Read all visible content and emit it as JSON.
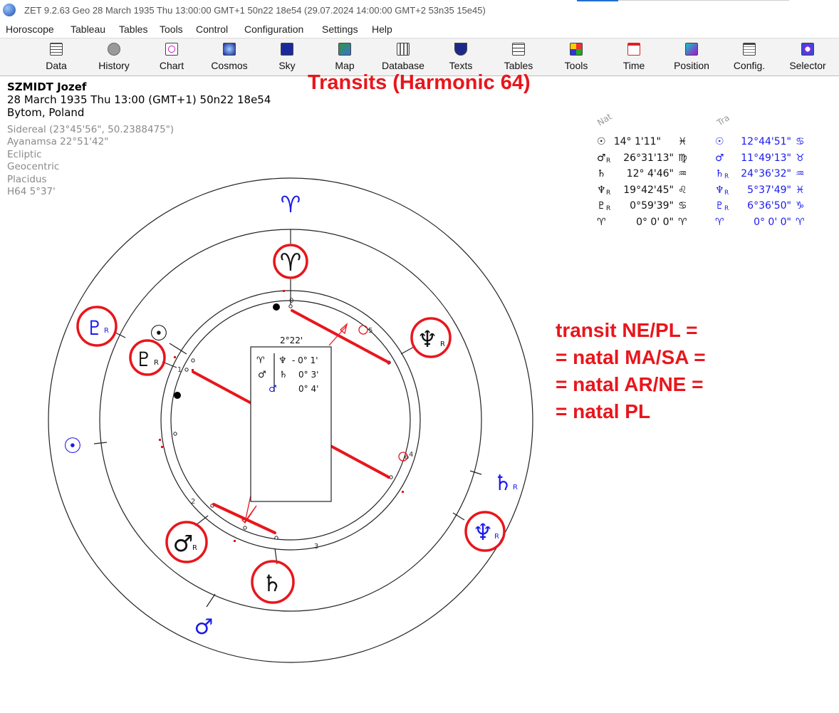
{
  "window": {
    "title": "ZET 9.2.63 Geo   28 March 1935  Thu  13:00:00 GMT+1 50n22  18e54  (29.07.2024  14:00:00 GMT+2 53n35 15e45)"
  },
  "menu": [
    "Horoscope",
    "Tableau",
    "Tables",
    "Tools",
    "Control",
    "Configuration",
    "Settings",
    "Help"
  ],
  "toolbar": [
    "Data",
    "History",
    "Chart",
    "Cosmos",
    "Sky",
    "Map",
    "Database",
    "Texts",
    "Tables",
    "Tools",
    "Time",
    "Position",
    "Config.",
    "Selector"
  ],
  "chart_title": "Transits (Harmonic 64)",
  "person": {
    "name": "SZMIDT Jozef",
    "datetime": "28 March 1935  Thu  13:00 (GMT+1) 50n22  18e54",
    "place": "Bytom, Poland",
    "settings": [
      "Sidereal (23°45'56\", 50.2388475\")",
      "Ayanamsa 22°51'42\"",
      "Ecliptic",
      "Geocentric",
      "Placidus",
      "H64   5°37'"
    ]
  },
  "table": {
    "nat_header": "Nat",
    "tra_header": "Tra",
    "nat_rows": [
      {
        "glyph": "☉",
        "retro": "",
        "pos": "14° 1'11\"",
        "sign": "♓"
      },
      {
        "glyph": "♂",
        "retro": "R",
        "pos": "26°31'13\"",
        "sign": "♍"
      },
      {
        "glyph": "♄",
        "retro": "",
        "pos": "12° 4'46\"",
        "sign": "♒"
      },
      {
        "glyph": "♆",
        "retro": "R",
        "pos": "19°42'45\"",
        "sign": "♌"
      },
      {
        "glyph": "♇",
        "retro": "R",
        "pos": "0°59'39\"",
        "sign": "♋"
      },
      {
        "glyph": "♈",
        "retro": "",
        "pos": "0° 0' 0\"",
        "sign": "♈"
      }
    ],
    "tra_rows": [
      {
        "glyph": "☉",
        "retro": "",
        "pos": "12°44'51\"",
        "sign": "♋"
      },
      {
        "glyph": "♂",
        "retro": "",
        "pos": "11°49'13\"",
        "sign": "♉"
      },
      {
        "glyph": "♄",
        "retro": "R",
        "pos": "24°36'32\"",
        "sign": "♒"
      },
      {
        "glyph": "♆",
        "retro": "R",
        "pos": "5°37'49\"",
        "sign": "♓"
      },
      {
        "glyph": "♇",
        "retro": "R",
        "pos": "6°36'50\"",
        "sign": "♑"
      },
      {
        "glyph": "♈",
        "retro": "",
        "pos": "0° 0' 0\"",
        "sign": "♈"
      }
    ]
  },
  "chart": {
    "midpoint_box": {
      "header": "2°22'",
      "rows": [
        {
          "a": "♈",
          "b": "♆",
          "value": "- 0° 1'"
        },
        {
          "a": "♂",
          "b": "♄",
          "value": "0° 3'"
        },
        {
          "a": "",
          "b": "♂",
          "value": "0° 4'"
        }
      ]
    },
    "house_numbers": [
      "0",
      "1",
      "2",
      "3",
      "4",
      "5"
    ],
    "inner_glyphs": {
      "aries": "♈",
      "sun": "☉",
      "pluto": "♇",
      "mars": "♂",
      "saturn": "♄",
      "neptune": "♆",
      "retro": "R"
    },
    "outer_glyphs": {
      "aries": "♈",
      "pluto": "♇",
      "sun": "☉",
      "mars": "♂",
      "saturn": "♄",
      "neptune": "♆",
      "retro": "R"
    }
  },
  "annotation": [
    "transit NE/PL =",
    "= natal MA/SA =",
    "= natal AR/NE =",
    "= natal PL"
  ],
  "colors": {
    "accent": "#e8161c",
    "transit": "#1a1aee",
    "grey": "#8a8a8a"
  }
}
